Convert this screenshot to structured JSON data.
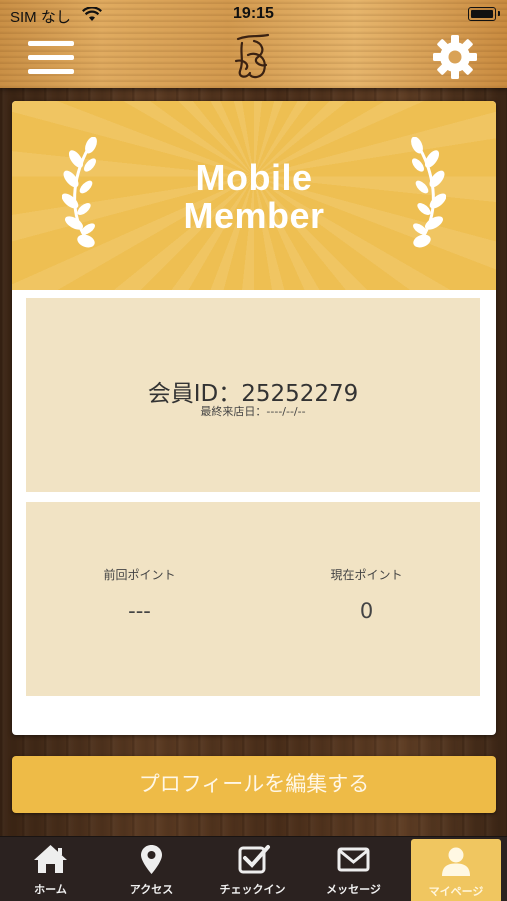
{
  "status_bar": {
    "carrier": "SIM なし",
    "time": "19:15"
  },
  "header": {
    "menu_icon": "hamburger-menu-icon",
    "logo_icon": "shop-logo-icon",
    "settings_icon": "gear-icon"
  },
  "card": {
    "banner_line1": "Mobile",
    "banner_line2": "Member",
    "member_id": "会員ID：25252279",
    "last_visit": "最終来店日：----/--/--",
    "prev_points_label": "前回ポイント",
    "prev_points_value": "---",
    "current_points_label": "現在ポイント",
    "current_points_value": "0"
  },
  "edit_profile_label": "プロフィールを編集する",
  "tabs": [
    {
      "label": "ホーム",
      "icon": "home-icon"
    },
    {
      "label": "アクセス",
      "icon": "map-pin-icon"
    },
    {
      "label": "チェックイン",
      "icon": "checkbox-icon"
    },
    {
      "label": "メッセージ",
      "icon": "envelope-icon"
    },
    {
      "label": "マイページ",
      "icon": "person-icon",
      "active": true
    }
  ],
  "colors": {
    "accent": "#eebb47",
    "banner": "#eebf52",
    "panel": "#f1e3c4",
    "tabbar": "#2b2220"
  }
}
